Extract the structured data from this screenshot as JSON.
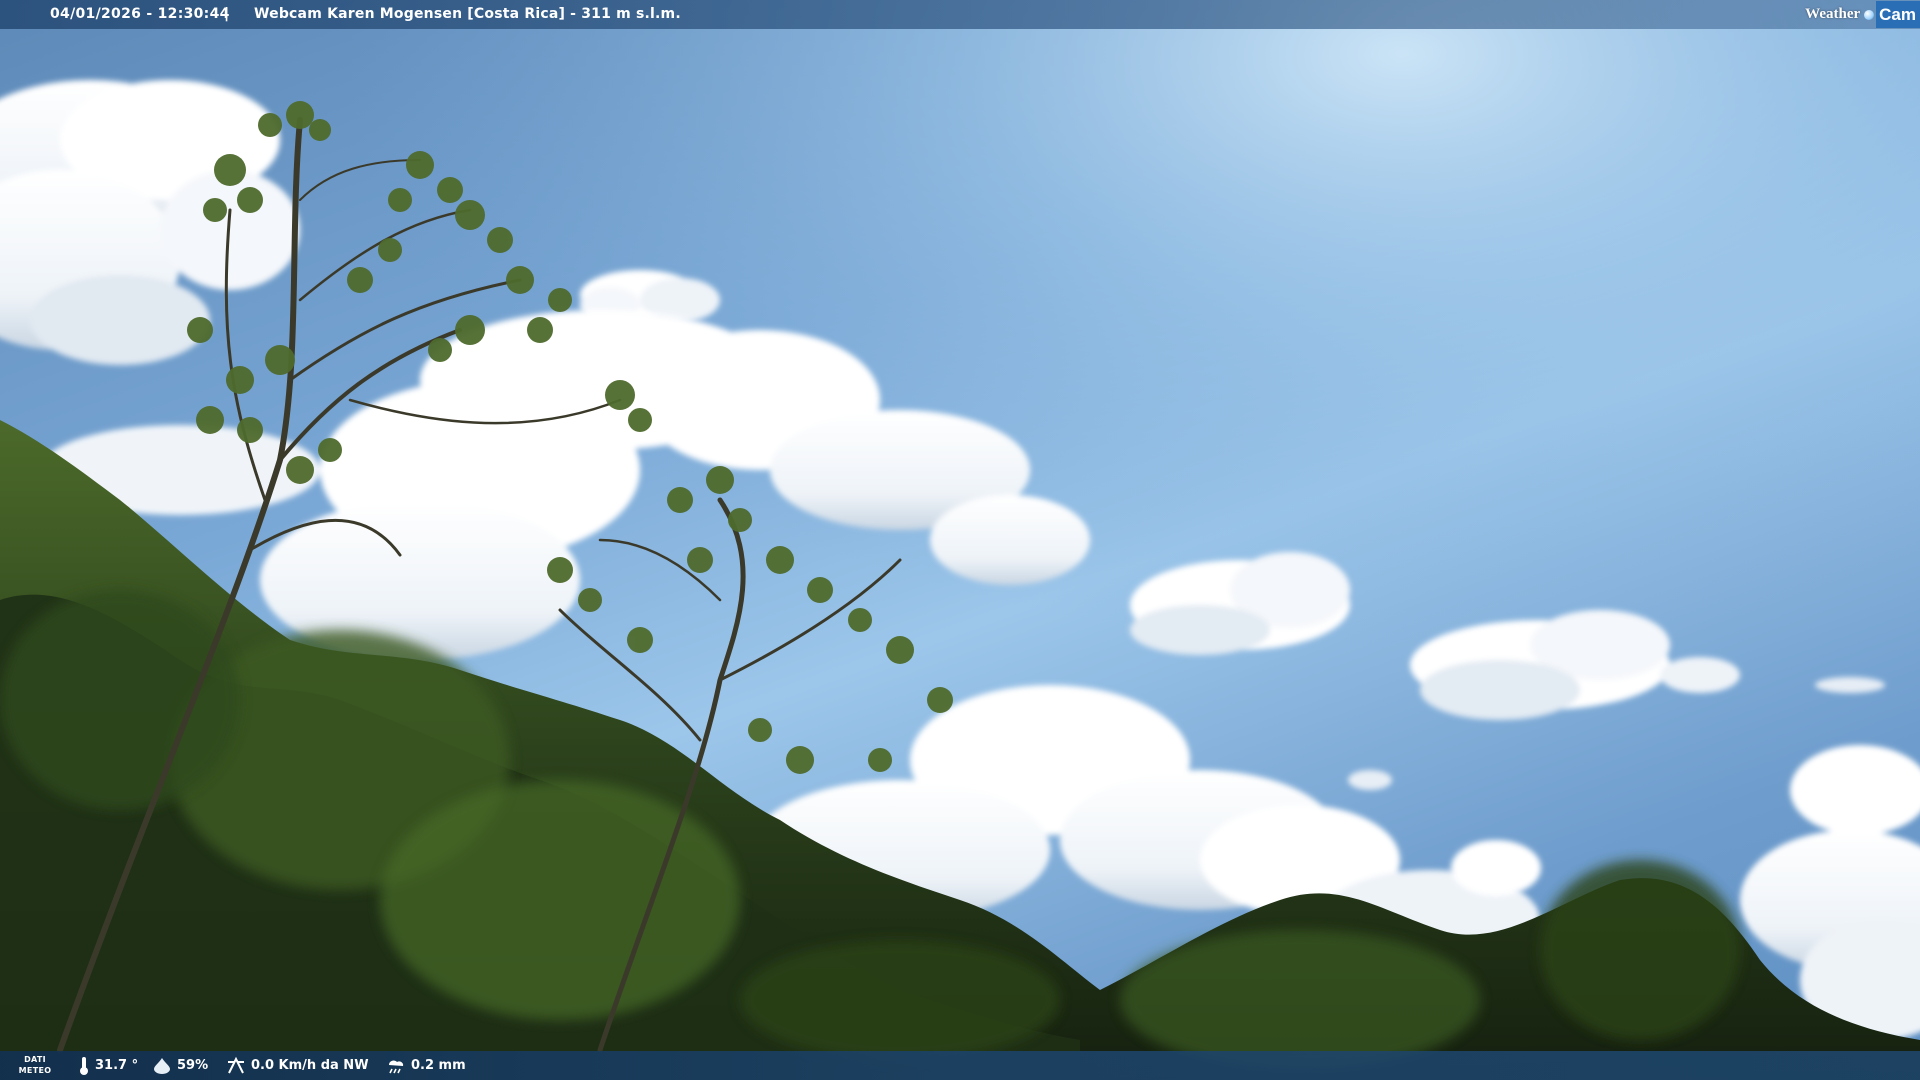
{
  "top_bar": {
    "datetime": "04/01/2026 - 12:30:44",
    "separator": "|",
    "title": "Webcam Karen Mogensen [Costa Rica] - 311 m s.l.m."
  },
  "logo": {
    "word1": "Weather",
    "word2": "Cam"
  },
  "bottom_bar": {
    "label_line1": "DATI",
    "label_line2": "METEO",
    "temperature": "31.7 °",
    "humidity": "59%",
    "wind": "0.0 Km/h da NW",
    "rain": "0.2 mm"
  },
  "colors": {
    "sky_top": "#5d89b8",
    "sky_bright": "#a8cfee",
    "foliage_dark": "#1e2f18",
    "foliage_light": "#5b7a2e",
    "bar_bg": "#1c4268"
  },
  "icons": {
    "temperature": "thermometer-icon",
    "humidity": "humidity-drop-icon",
    "wind": "wind-icon",
    "rain": "rain-icon"
  }
}
